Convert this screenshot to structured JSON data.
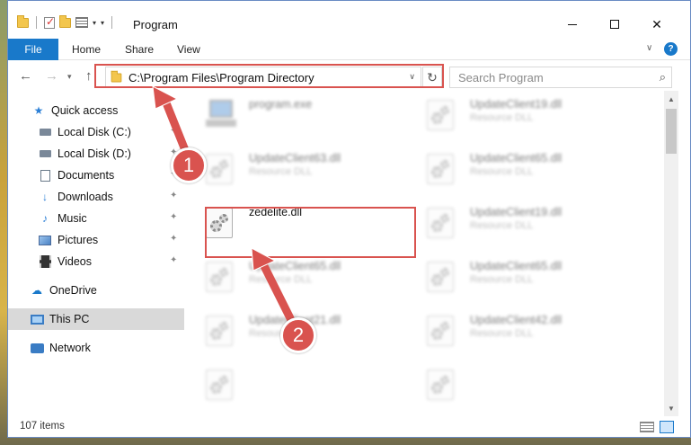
{
  "window": {
    "title": "Program",
    "controls": {
      "minimize": "minimize-icon",
      "maximize": "maximize-icon",
      "close": "close-icon"
    }
  },
  "ribbon": {
    "tabs": [
      "File",
      "Home",
      "Share",
      "View"
    ],
    "help_label": "?"
  },
  "navigation": {
    "address": "C:\\Program Files\\Program Directory",
    "search_placeholder": "Search Program"
  },
  "sidebar": {
    "items": [
      {
        "label": "Quick access",
        "icon": "star-icon"
      },
      {
        "label": "Local Disk (C:)",
        "icon": "drive-icon",
        "pinned": true
      },
      {
        "label": "Local Disk (D:)",
        "icon": "drive-icon",
        "pinned": true
      },
      {
        "label": "Documents",
        "icon": "document-icon",
        "pinned": true
      },
      {
        "label": "Downloads",
        "icon": "download-icon",
        "pinned": true
      },
      {
        "label": "Music",
        "icon": "music-icon",
        "pinned": true
      },
      {
        "label": "Pictures",
        "icon": "picture-icon",
        "pinned": true
      },
      {
        "label": "Videos",
        "icon": "video-icon",
        "pinned": true
      },
      {
        "label": "OneDrive",
        "icon": "cloud-icon"
      },
      {
        "label": "This PC",
        "icon": "computer-icon",
        "selected": true
      },
      {
        "label": "Network",
        "icon": "network-icon"
      }
    ]
  },
  "files": [
    {
      "name": "program.exe",
      "type": "",
      "icon": "application-icon",
      "blurred": true
    },
    {
      "name": "UpdateClient19.dll",
      "type": "Resource DLL",
      "icon": "dll-gear-icon",
      "blurred": true
    },
    {
      "name": "UpdateClient63.dll",
      "type": "Resource DLL",
      "icon": "dll-gear-icon",
      "blurred": true
    },
    {
      "name": "UpdateClient65.dll",
      "type": "Resource DLL",
      "icon": "dll-gear-icon",
      "blurred": true
    },
    {
      "name": "zedelite.dll",
      "type": "",
      "icon": "dll-gear-icon",
      "blurred": false
    },
    {
      "name": "UpdateClient19.dll",
      "type": "Resource DLL",
      "icon": "dll-gear-icon",
      "blurred": true
    },
    {
      "name": "UpdateClient65.dll",
      "type": "Resource DLL",
      "icon": "dll-gear-icon",
      "blurred": true
    },
    {
      "name": "UpdateClient65.dll",
      "type": "Resource DLL",
      "icon": "dll-gear-icon",
      "blurred": true
    },
    {
      "name": "UpdateClient21.dll",
      "type": "Resource DLL",
      "icon": "dll-gear-icon",
      "blurred": true
    },
    {
      "name": "UpdateClient42.dll",
      "type": "Resource DLL",
      "icon": "dll-gear-icon",
      "blurred": true
    },
    {
      "name": "",
      "type": "",
      "icon": "dll-gear-icon",
      "blurred": true
    },
    {
      "name": "",
      "type": "",
      "icon": "dll-gear-icon",
      "blurred": true
    }
  ],
  "status": {
    "item_count": "107 items"
  },
  "annotations": {
    "step1": "1",
    "step2": "2",
    "color": "#d9534f"
  }
}
